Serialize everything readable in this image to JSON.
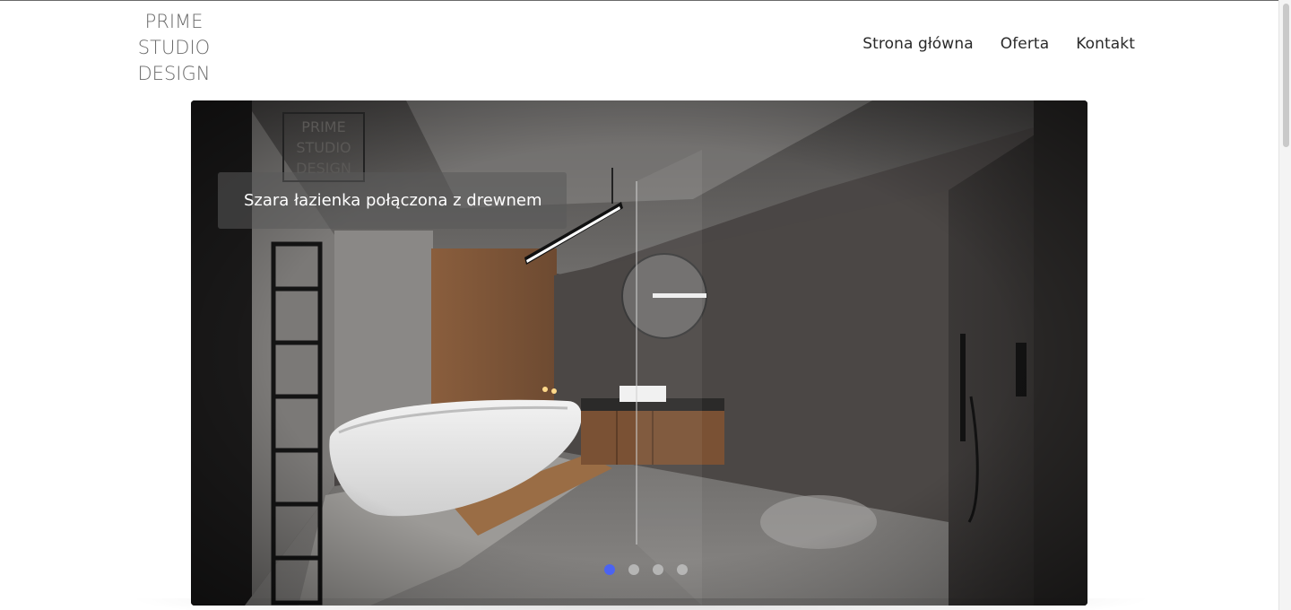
{
  "logo": {
    "line1": "PRIME",
    "line2": "STUDIO",
    "line3": "DESIGN"
  },
  "nav": {
    "items": [
      {
        "label": "Strona główna"
      },
      {
        "label": "Oferta"
      },
      {
        "label": "Kontakt"
      }
    ]
  },
  "slider": {
    "caption": "Szara łazienka połączona z drewnem",
    "watermark": {
      "line1": "PRIME",
      "line2": "STUDIO",
      "line3": "DESIGN"
    },
    "slide_count": 4,
    "active_slide": 1
  },
  "colors": {
    "accent": "#4b63f2",
    "nav_text": "#2a2a2a",
    "logo_text": "#6b6b6b"
  }
}
